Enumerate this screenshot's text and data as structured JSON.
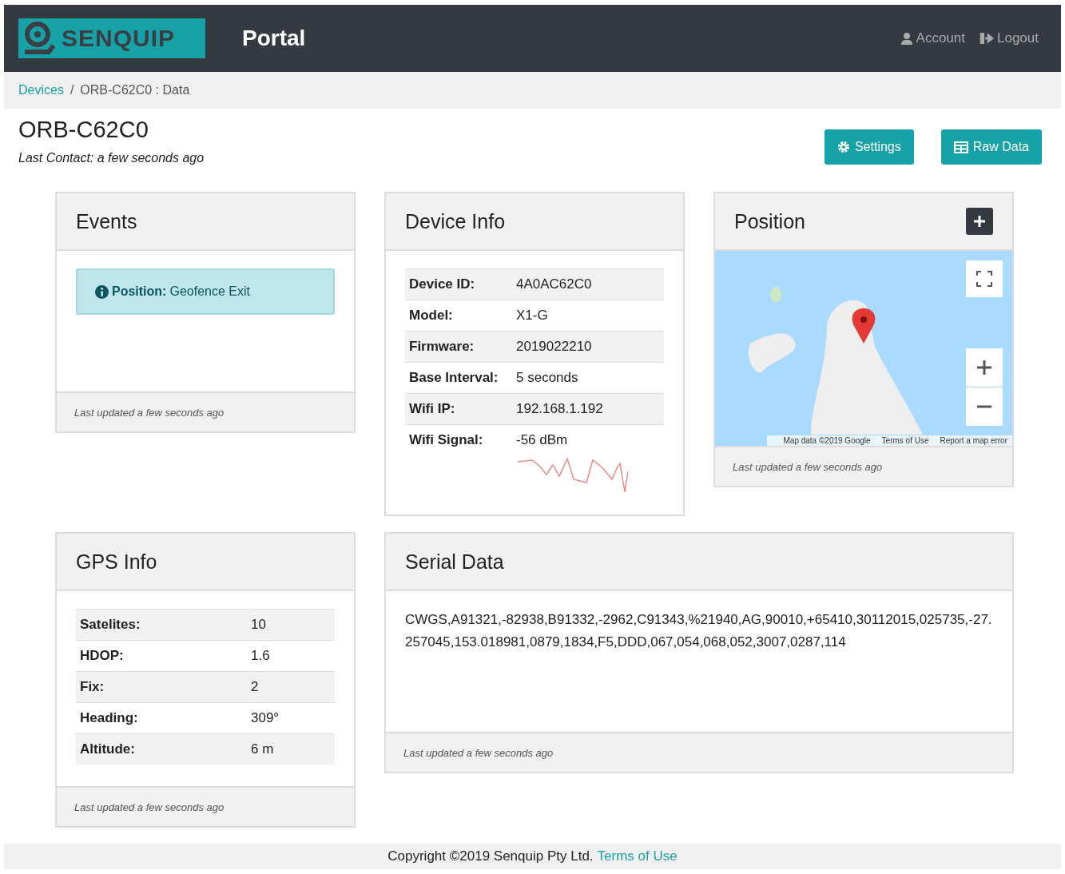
{
  "navbar": {
    "brand": "SENQUIP",
    "title": "Portal",
    "links": [
      {
        "kind": "account",
        "label": "Account"
      },
      {
        "kind": "logout",
        "label": "Logout"
      }
    ]
  },
  "breadcrumb": [
    {
      "label": "Devices",
      "link": true
    },
    {
      "label": "ORB-C62C0 : Data",
      "link": false
    }
  ],
  "breadcrumb_separator": "/",
  "header": {
    "title": "ORB-C62C0",
    "subtitle": "Last Contact: a few seconds ago",
    "buttons": [
      {
        "kind": "settings",
        "label": "Settings"
      },
      {
        "kind": "table",
        "label": "Raw Data"
      }
    ]
  },
  "events": {
    "title": "Events",
    "alerts": [
      {
        "label": "Position:",
        "text": "Geofence Exit"
      }
    ],
    "footer": "Last updated a few seconds ago"
  },
  "device_info": {
    "title": "Device Info",
    "rows": [
      {
        "label": "Device ID:",
        "value": "4A0AC62C0"
      },
      {
        "label": "Model:",
        "value": "X1-G"
      },
      {
        "label": "Firmware:",
        "value": "2019022210"
      },
      {
        "label": "Base Interval:",
        "value": "5 seconds"
      },
      {
        "label": "Wifi IP:",
        "value": "192.168.1.192"
      },
      {
        "label": "Wifi Signal:",
        "value": "-56 dBm",
        "sparkline": true
      }
    ]
  },
  "position": {
    "title": "Position",
    "attribution": [
      "Map data ©2019 Google",
      "Terms of Use",
      "Report a map error"
    ],
    "footer": "Last updated a few seconds ago"
  },
  "gps_info": {
    "title": "GPS Info",
    "rows": [
      {
        "label": "Satelites:",
        "value": "10"
      },
      {
        "label": "HDOP:",
        "value": "1.6"
      },
      {
        "label": "Fix:",
        "value": "2"
      },
      {
        "label": "Heading:",
        "value": "309°"
      },
      {
        "label": "Altitude:",
        "value": "6 m"
      }
    ],
    "footer": "Last updated a few seconds ago"
  },
  "serial_data": {
    "title": "Serial Data",
    "text": "CWGS,A91321,-82938,B91332,-2962,C91343,%21940,AG,90010,+65410,30112015,025735,-27.257045,153.018981,0879,1834,F5,DDD,067,054,068,052,3007,0287,114",
    "footer": "Last updated a few seconds ago"
  },
  "footer": {
    "text": "Copyright ©2019 Senquip Pty Ltd.",
    "link": "Terms of Use"
  }
}
